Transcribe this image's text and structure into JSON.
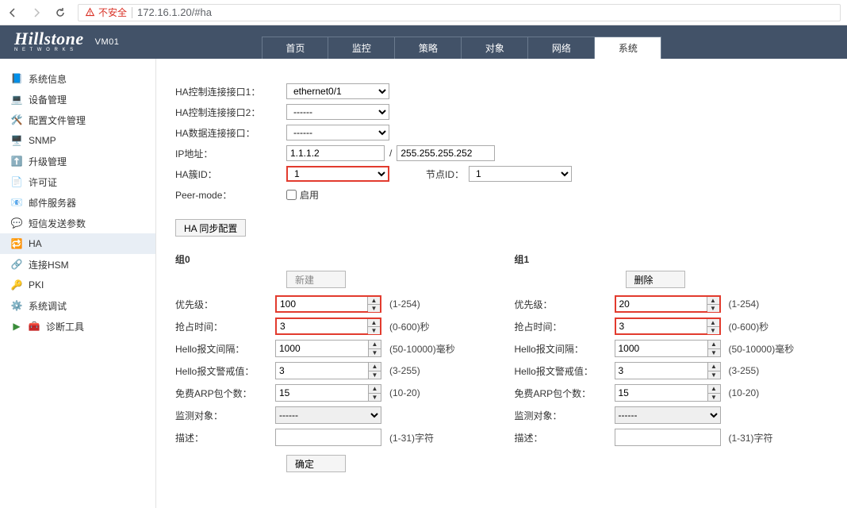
{
  "browser": {
    "insecure_label": "不安全",
    "url": "172.16.1.20/#ha"
  },
  "brand": {
    "name": "Hillstone",
    "sub": "VM01",
    "net": "N E T W O R K S"
  },
  "tabs": [
    "首页",
    "监控",
    "策略",
    "对象",
    "网络",
    "系统"
  ],
  "active_tab": "系统",
  "sidebar": [
    "系统信息",
    "设备管理",
    "配置文件管理",
    "SNMP",
    "升级管理",
    "许可证",
    "邮件服务器",
    "短信发送参数",
    "HA",
    "连接HSM",
    "PKI",
    "系统调试",
    "诊断工具"
  ],
  "form": {
    "ha_ctrl1_lbl": "HA控制连接接口1：",
    "ha_ctrl1_val": "ethernet0/1",
    "ha_ctrl2_lbl": "HA控制连接接口2：",
    "ha_ctrl2_val": "------",
    "ha_data_lbl": "HA数据连接接口：",
    "ha_data_val": "------",
    "ip_lbl": "IP地址：",
    "ip_val": "1.1.1.2",
    "mask_val": "255.255.255.252",
    "cluster_lbl": "HA簇ID：",
    "cluster_val": "1",
    "node_lbl": "节点ID：",
    "node_val": "1",
    "peer_lbl": "Peer-mode：",
    "peer_chk": "启用",
    "sync_btn": "HA 同步配置"
  },
  "group0": {
    "title": "组0",
    "action": "新建",
    "priority_lbl": "优先级：",
    "priority_val": "100",
    "priority_hint": "(1-254)",
    "preempt_lbl": "抢占时间：",
    "preempt_val": "3",
    "preempt_hint": "(0-600)秒",
    "hello_int_lbl": "Hello报文间隔：",
    "hello_int_val": "1000",
    "hello_int_hint": "(50-10000)毫秒",
    "hello_thr_lbl": "Hello报文警戒值：",
    "hello_thr_val": "3",
    "hello_thr_hint": "(3-255)",
    "arp_lbl": "免费ARP包个数：",
    "arp_val": "15",
    "arp_hint": "(10-20)",
    "mon_lbl": "监测对象：",
    "mon_val": "------",
    "desc_lbl": "描述：",
    "desc_hint": "(1-31)字符"
  },
  "group1": {
    "title": "组1",
    "action": "删除",
    "priority_lbl": "优先级：",
    "priority_val": "20",
    "priority_hint": "(1-254)",
    "preempt_lbl": "抢占时间：",
    "preempt_val": "3",
    "preempt_hint": "(0-600)秒",
    "hello_int_lbl": "Hello报文间隔：",
    "hello_int_val": "1000",
    "hello_int_hint": "(50-10000)毫秒",
    "hello_thr_lbl": "Hello报文警戒值：",
    "hello_thr_val": "3",
    "hello_thr_hint": "(3-255)",
    "arp_lbl": "免费ARP包个数：",
    "arp_val": "15",
    "arp_hint": "(10-20)",
    "mon_lbl": "监测对象：",
    "mon_val": "------",
    "desc_lbl": "描述：",
    "desc_hint": "(1-31)字符"
  },
  "confirm": "确定"
}
